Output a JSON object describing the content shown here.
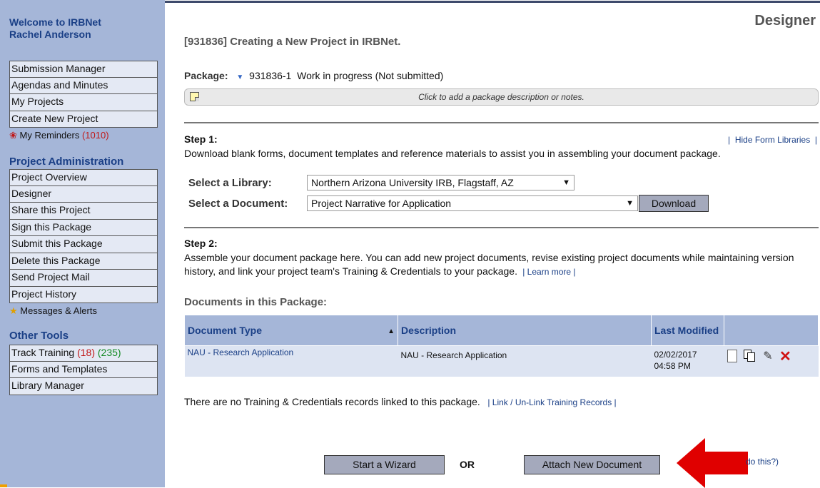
{
  "sidebar": {
    "welcome_line1": "Welcome to IRBNet",
    "welcome_line2": "Rachel Anderson",
    "nav1": [
      {
        "label": "Submission Manager"
      },
      {
        "label": "Agendas and Minutes"
      },
      {
        "label": "My Projects"
      },
      {
        "label": "Create New Project"
      }
    ],
    "reminders": {
      "label": "My Reminders",
      "count": "(1010)"
    },
    "project_admin_title": "Project Administration",
    "nav2": [
      {
        "label": "Project Overview"
      },
      {
        "label": "Designer"
      },
      {
        "label": "Share this Project"
      },
      {
        "label": "Sign this Package"
      },
      {
        "label": "Submit this Package"
      },
      {
        "label": "Delete this Package"
      },
      {
        "label": "Send Project Mail"
      },
      {
        "label": "Project History"
      }
    ],
    "messages": "Messages & Alerts",
    "other_tools_title": "Other Tools",
    "track_training": {
      "label": "Track Training",
      "count_red": "(18)",
      "count_green": "(235)"
    },
    "nav3": [
      {
        "label": "Forms and Templates"
      },
      {
        "label": "Library Manager"
      }
    ]
  },
  "main": {
    "section_title": "Designer",
    "project_title": "[931836] Creating a New Project in IRBNet.",
    "package_label": "Package:",
    "package_id": "931836-1",
    "package_status": "Work in progress (Not submitted)",
    "notes_placeholder": "Click to add a package description or notes.",
    "step1": {
      "title": "Step 1:",
      "hide_link": "Hide Form Libraries",
      "text": "Download blank forms, document templates and reference materials to assist you in assembling your document package.",
      "library_label": "Select a Library:",
      "library_value": "Northern Arizona University IRB, Flagstaff, AZ",
      "document_label": "Select a Document:",
      "document_value": "Project Narrative for Application",
      "download_button": "Download"
    },
    "step2": {
      "title": "Step 2:",
      "text": "Assemble your document package here. You can add new project documents, revise existing project documents while maintaining version history, and link your project team's Training & Credentials to your package.",
      "learn_more": "Learn more"
    },
    "docs_label": "Documents in this Package:",
    "table": {
      "headers": [
        "Document Type",
        "Description",
        "Last Modified",
        ""
      ],
      "rows": [
        {
          "type": "NAU - Research Application",
          "description": "NAU - Research Application",
          "date": "02/02/2017",
          "time": "04:58 PM"
        }
      ]
    },
    "training_text": "There are no Training & Credentials records linked to this package.",
    "training_link": "Link / Un-Link Training Records",
    "wizard_button": "Start a Wizard",
    "or_text": "OR",
    "attach_button": "Attach New Document",
    "howto_link": "do this?)"
  },
  "colors": {
    "sidebar_bg": "#a5b6d8",
    "nav_item_bg": "#e4e9f4",
    "heading_blue": "#1a3f86",
    "button_bg": "#a4a9bc",
    "alert_red": "#c01818",
    "arrow_red": "#e00000"
  },
  "icons": {
    "reminders": "flag-icon",
    "messages": "bell-alert-icon",
    "notes": "sticky-note-icon",
    "actions": [
      "document-icon",
      "copy-icon",
      "pencil-icon",
      "delete-x-icon"
    ]
  }
}
